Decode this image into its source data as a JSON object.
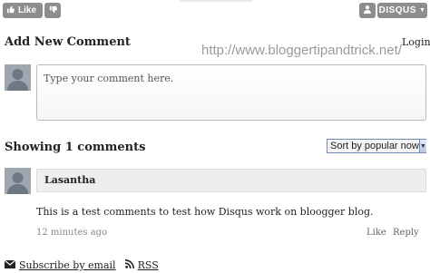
{
  "toolbar": {
    "like_label": "Like",
    "disqus_label": "DISQUS"
  },
  "add_comment": {
    "title": "Add New Comment",
    "login_label": "Login",
    "placeholder": "Type your comment here."
  },
  "watermark": "http://www.bloggertipandtrick.net/",
  "comments_header": {
    "title": "Showing 1 comments",
    "sort_selected": "Sort by popular now"
  },
  "comments": [
    {
      "author": "Lasantha",
      "text": "This is a test comments to test how Disqus work on bloogger blog.",
      "time": "12 minutes ago",
      "like_label": "Like",
      "reply_label": "Reply"
    }
  ],
  "footer": {
    "subscribe_label": "Subscribe by email",
    "rss_label": "RSS"
  },
  "colors": {
    "button_gray": "#8d8d8d",
    "author_bar_bg": "#eeeeee",
    "watermark": "#9a9a9a",
    "select_border": "#6f8ab5"
  },
  "icons": {
    "like": "thumbs-up-icon",
    "dislike": "thumbs-down-icon",
    "account": "user-icon",
    "subscribe": "envelope-icon",
    "rss": "rss-icon",
    "avatar": "default-avatar-icon"
  }
}
